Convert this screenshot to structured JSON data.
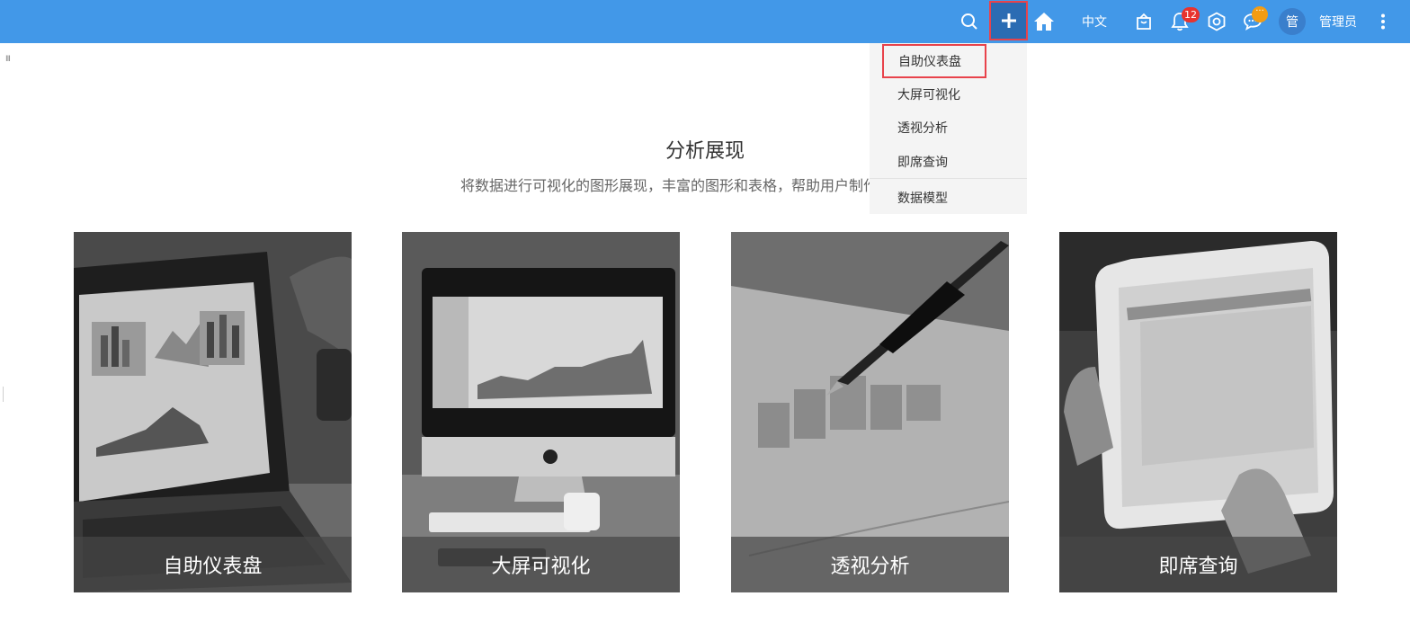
{
  "topbar": {
    "language_label": "中文",
    "notification_count": "12",
    "chat_badge": "···",
    "avatar_text": "管",
    "user_name": "管理员",
    "accent_color": "#4298e8",
    "icons": [
      "search-icon",
      "plus-icon",
      "home-icon",
      "shopping-bag-icon",
      "bell-icon",
      "settings-icon",
      "chat-icon",
      "more-vertical-icon"
    ]
  },
  "side_handle": "III",
  "dropdown": {
    "items": [
      {
        "label": "自助仪表盘",
        "highlighted": true
      },
      {
        "label": "大屏可视化"
      },
      {
        "label": "透视分析"
      },
      {
        "label": "即席查询"
      },
      {
        "label": "数据模型"
      }
    ]
  },
  "section": {
    "title": "分析展现",
    "subtitle": "将数据进行可视化的图形展现，丰富的图形和表格，帮助用户制作更好的报告"
  },
  "cards": [
    {
      "label": "自助仪表盘"
    },
    {
      "label": "大屏可视化"
    },
    {
      "label": "透视分析"
    },
    {
      "label": "即席查询"
    }
  ]
}
